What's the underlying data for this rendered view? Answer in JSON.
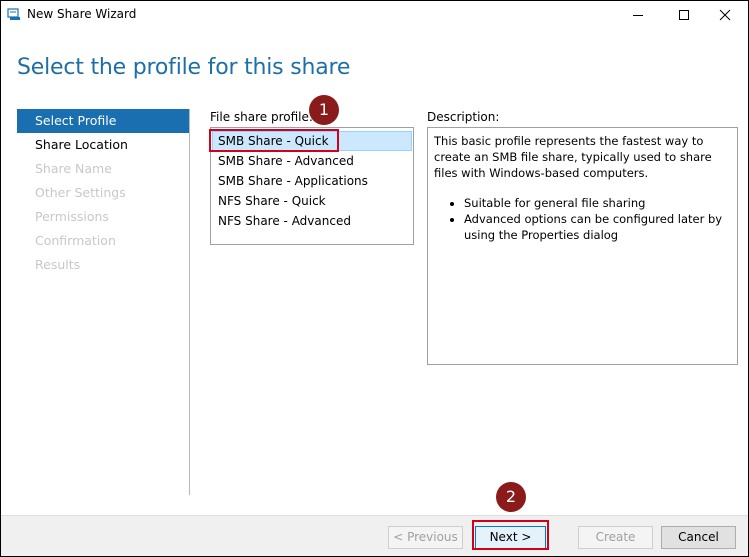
{
  "window": {
    "title": "New Share Wizard",
    "minimize_glyph": "—",
    "maximize_glyph": "☐",
    "close_glyph": "✕"
  },
  "page": {
    "title": "Select the profile for this share"
  },
  "nav": {
    "items": [
      {
        "label": "Select Profile",
        "state": "active"
      },
      {
        "label": "Share Location",
        "state": "enabled"
      },
      {
        "label": "Share Name",
        "state": "disabled"
      },
      {
        "label": "Other Settings",
        "state": "disabled"
      },
      {
        "label": "Permissions",
        "state": "disabled"
      },
      {
        "label": "Confirmation",
        "state": "disabled"
      },
      {
        "label": "Results",
        "state": "disabled"
      }
    ]
  },
  "profiles": {
    "label": "File share profile:",
    "selected": "SMB Share - Quick",
    "items": [
      "SMB Share - Quick",
      "SMB Share - Advanced",
      "SMB Share - Applications",
      "NFS Share - Quick",
      "NFS Share - Advanced"
    ]
  },
  "description": {
    "label": "Description:",
    "text": "This basic profile represents the fastest way to create an SMB file share, typically used to share files with Windows-based computers.",
    "bullets": [
      "Suitable for general file sharing",
      "Advanced options can be configured later by using the Properties dialog"
    ]
  },
  "annotations": {
    "badge_1": "1",
    "badge_2": "2",
    "color": "#d0021b"
  },
  "buttons": {
    "previous": "< Previous",
    "next": "Next >",
    "create": "Create",
    "cancel": "Cancel"
  },
  "colors": {
    "title": "#1e6fa5",
    "nav_active_bg": "#1a6fb0",
    "selection_bg": "#cce8ff"
  }
}
